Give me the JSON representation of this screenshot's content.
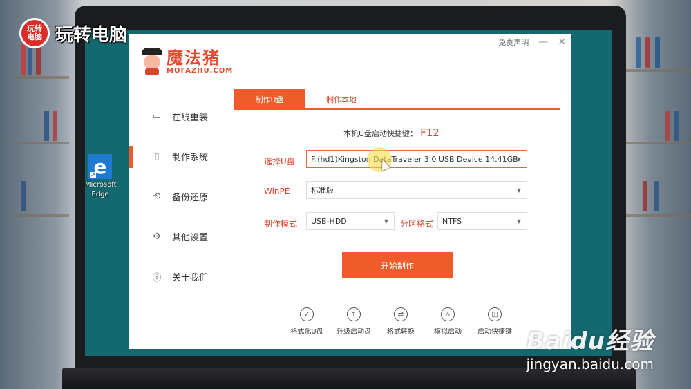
{
  "brand": {
    "badge": "玩转电脑",
    "text": "玩转电脑"
  },
  "desktop": {
    "edge_label_line1": "Microsoft",
    "edge_label_line2": "Edge"
  },
  "app": {
    "disclaimer": "免责声明",
    "min_glyph": "—",
    "close_glyph": "✕",
    "logo_main": "魔法猪",
    "logo_sub": "MOFAZHU.COM",
    "sidebar": [
      {
        "label": "在线重装",
        "icon": "monitor-icon",
        "glyph": "▭",
        "active": false
      },
      {
        "label": "制作系统",
        "icon": "usb-icon",
        "glyph": "▯",
        "active": true
      },
      {
        "label": "备份还原",
        "icon": "backup-icon",
        "glyph": "⟲",
        "active": false
      },
      {
        "label": "其他设置",
        "icon": "gear-icon",
        "glyph": "⚙",
        "active": false
      },
      {
        "label": "关于我们",
        "icon": "info-icon",
        "glyph": "ⓘ",
        "active": false
      }
    ],
    "tabs": [
      {
        "label": "制作U盘",
        "active": true
      },
      {
        "label": "制作本地",
        "active": false
      }
    ],
    "hotkey_label": "本机U盘启动快捷键：",
    "hotkey_value": "F12",
    "select_usb_label": "选择U盘",
    "select_usb_value": "F:(hd1)Kingston DataTraveler 3.0 USB Device 14.41GB",
    "winpe_label": "WinPE",
    "winpe_value": "标准版",
    "mode_label": "制作模式",
    "mode_value": "USB-HDD",
    "partition_label": "分区格式",
    "partition_value": "NTFS",
    "start_label": "开始制作",
    "tools": [
      {
        "label": "格式化U盘",
        "icon": "check-circle-icon",
        "glyph": "✓"
      },
      {
        "label": "升级启动盘",
        "icon": "upgrade-icon",
        "glyph": "↑"
      },
      {
        "label": "格式转换",
        "icon": "convert-icon",
        "glyph": "⇄"
      },
      {
        "label": "模拟启动",
        "icon": "simulate-icon",
        "glyph": "⌂"
      },
      {
        "label": "启动快捷键",
        "icon": "mouse-icon",
        "glyph": "◫"
      }
    ]
  },
  "watermark": {
    "logo": "Baidu经验",
    "url": "jingyan.baidu.com"
  }
}
